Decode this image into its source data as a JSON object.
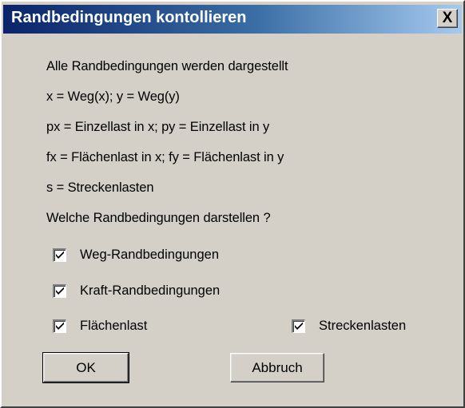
{
  "window": {
    "title": "Randbedingungen kontollieren",
    "close_label": "X"
  },
  "info_lines": [
    "Alle Randbedingungen werden dargestellt",
    "x = Weg(x); y = Weg(y)",
    "px = Einzellast in x; py = Einzellast in y",
    "fx = Flächenlast in x; fy = Flächenlast in y",
    "s = Streckenlasten",
    "Welche Randbedingungen darstellen ?"
  ],
  "options": [
    {
      "label": "Weg-Randbedingungen",
      "checked": true
    },
    {
      "label": "Kraft-Randbedingungen",
      "checked": true
    },
    {
      "label": "Flächenlast",
      "checked": true
    },
    {
      "label": "Streckenlasten",
      "checked": true
    }
  ],
  "buttons": {
    "ok_label": "OK",
    "cancel_label": "Abbruch"
  },
  "colors": {
    "title_gradient_start": "#0a246a",
    "title_gradient_end": "#a6caf0",
    "face": "#d4d0c8"
  }
}
